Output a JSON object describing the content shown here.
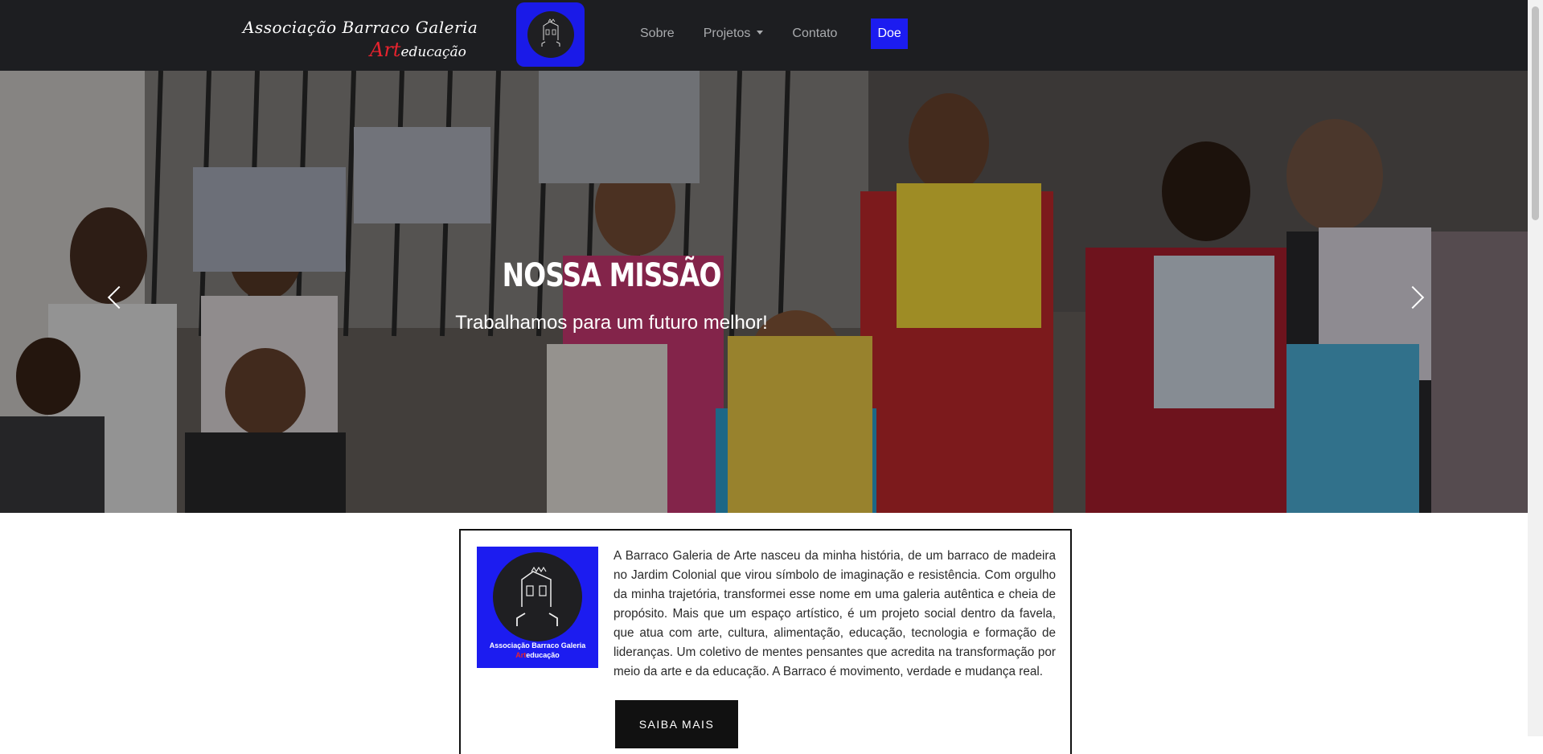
{
  "navbar": {
    "brand_line1": "Associação Barraco Galeria",
    "brand_line2_accent": "Art",
    "brand_line2_rest": "educação",
    "links": [
      "Sobre",
      "Projetos",
      "Contato"
    ],
    "donate_label": "Doe",
    "donate_color": "#1c1cf0"
  },
  "hero": {
    "title": "NOSSA MISSÃO",
    "subtitle": "Trabalhamos para um futuro melhor!",
    "prev_icon": "chevron-left-icon",
    "next_icon": "chevron-right-icon"
  },
  "about": {
    "logo_name": "Associação Barraco Galeria",
    "logo_accent": "Art",
    "logo_rest": "educação",
    "text": "A Barraco Galeria de Arte nasceu da minha história, de um barraco de madeira no Jardim Colonial que virou símbolo de imaginação e resistência. Com orgulho da minha trajetória, transformei esse nome em uma galeria autêntica e cheia de propósito. Mais que um espaço artístico, é um projeto social dentro da favela, que atua com arte, cultura, alimentação, educação, tecnologia e formação de lideranças. Um coletivo de mentes pensantes que acredita na transformação por meio da arte e da educação. A Barraco é movimento, verdade e mudança real.",
    "button_label": "SAIBA MAIS"
  },
  "colors": {
    "navbar_bg": "#1d1e21",
    "accent_blue": "#1c1cf0",
    "accent_red": "#e8232e"
  }
}
